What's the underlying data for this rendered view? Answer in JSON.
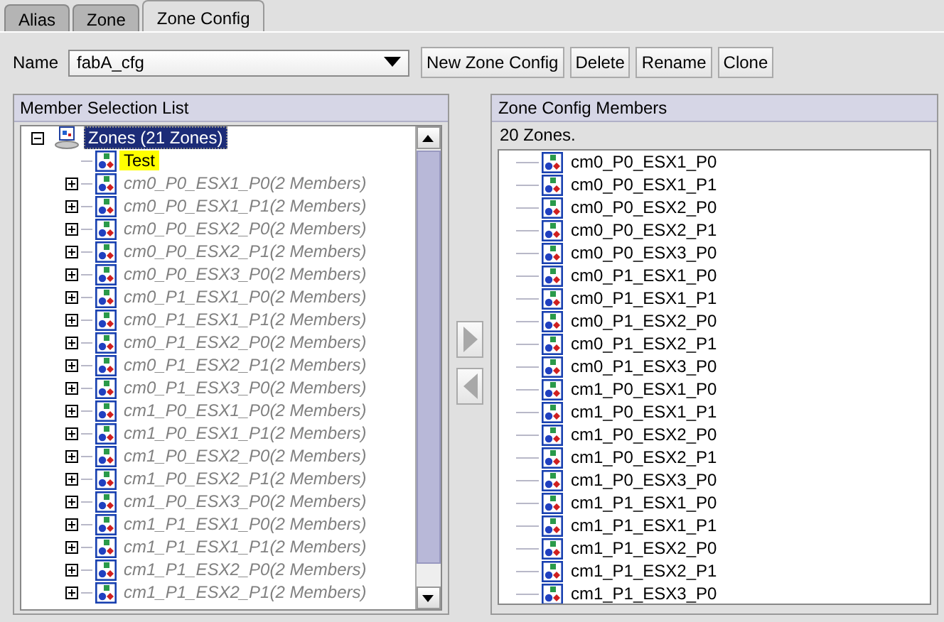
{
  "tabs": [
    {
      "label": "Alias",
      "selected": false
    },
    {
      "label": "Zone",
      "selected": false
    },
    {
      "label": "Zone Config",
      "selected": true
    }
  ],
  "name_field": {
    "label": "Name",
    "value": "fabA_cfg"
  },
  "buttons": [
    "New Zone Config",
    "Delete",
    "Rename",
    "Clone"
  ],
  "member_selection": {
    "title": "Member Selection List",
    "root": {
      "label": "Zones (21 Zones)",
      "selected": true,
      "expanded": true,
      "children": [
        {
          "label": "Test",
          "highlighted": true,
          "disabled": false,
          "expandable": false
        },
        {
          "label": "cm0_P0_ESX1_P0(2 Members)",
          "highlighted": false,
          "disabled": true,
          "expandable": true
        },
        {
          "label": "cm0_P0_ESX1_P1(2 Members)",
          "highlighted": false,
          "disabled": true,
          "expandable": true
        },
        {
          "label": "cm0_P0_ESX2_P0(2 Members)",
          "highlighted": false,
          "disabled": true,
          "expandable": true
        },
        {
          "label": "cm0_P0_ESX2_P1(2 Members)",
          "highlighted": false,
          "disabled": true,
          "expandable": true
        },
        {
          "label": "cm0_P0_ESX3_P0(2 Members)",
          "highlighted": false,
          "disabled": true,
          "expandable": true
        },
        {
          "label": "cm0_P1_ESX1_P0(2 Members)",
          "highlighted": false,
          "disabled": true,
          "expandable": true
        },
        {
          "label": "cm0_P1_ESX1_P1(2 Members)",
          "highlighted": false,
          "disabled": true,
          "expandable": true
        },
        {
          "label": "cm0_P1_ESX2_P0(2 Members)",
          "highlighted": false,
          "disabled": true,
          "expandable": true
        },
        {
          "label": "cm0_P1_ESX2_P1(2 Members)",
          "highlighted": false,
          "disabled": true,
          "expandable": true
        },
        {
          "label": "cm0_P1_ESX3_P0(2 Members)",
          "highlighted": false,
          "disabled": true,
          "expandable": true
        },
        {
          "label": "cm1_P0_ESX1_P0(2 Members)",
          "highlighted": false,
          "disabled": true,
          "expandable": true
        },
        {
          "label": "cm1_P0_ESX1_P1(2 Members)",
          "highlighted": false,
          "disabled": true,
          "expandable": true
        },
        {
          "label": "cm1_P0_ESX2_P0(2 Members)",
          "highlighted": false,
          "disabled": true,
          "expandable": true
        },
        {
          "label": "cm1_P0_ESX2_P1(2 Members)",
          "highlighted": false,
          "disabled": true,
          "expandable": true
        },
        {
          "label": "cm1_P0_ESX3_P0(2 Members)",
          "highlighted": false,
          "disabled": true,
          "expandable": true
        },
        {
          "label": "cm1_P1_ESX1_P0(2 Members)",
          "highlighted": false,
          "disabled": true,
          "expandable": true
        },
        {
          "label": "cm1_P1_ESX1_P1(2 Members)",
          "highlighted": false,
          "disabled": true,
          "expandable": true
        },
        {
          "label": "cm1_P1_ESX2_P0(2 Members)",
          "highlighted": false,
          "disabled": true,
          "expandable": true
        },
        {
          "label": "cm1_P1_ESX2_P1(2 Members)",
          "highlighted": false,
          "disabled": true,
          "expandable": true
        }
      ]
    }
  },
  "config_members": {
    "title": "Zone Config Members",
    "count": "20 Zones.",
    "items": [
      "cm0_P0_ESX1_P0",
      "cm0_P0_ESX1_P1",
      "cm0_P0_ESX2_P0",
      "cm0_P0_ESX2_P1",
      "cm0_P0_ESX3_P0",
      "cm0_P1_ESX1_P0",
      "cm0_P1_ESX1_P1",
      "cm0_P1_ESX2_P0",
      "cm0_P1_ESX2_P1",
      "cm0_P1_ESX3_P0",
      "cm1_P0_ESX1_P0",
      "cm1_P0_ESX1_P1",
      "cm1_P0_ESX2_P0",
      "cm1_P0_ESX2_P1",
      "cm1_P0_ESX3_P0",
      "cm1_P1_ESX1_P0",
      "cm1_P1_ESX1_P1",
      "cm1_P1_ESX2_P0",
      "cm1_P1_ESX2_P1",
      "cm1_P1_ESX3_P0"
    ]
  }
}
